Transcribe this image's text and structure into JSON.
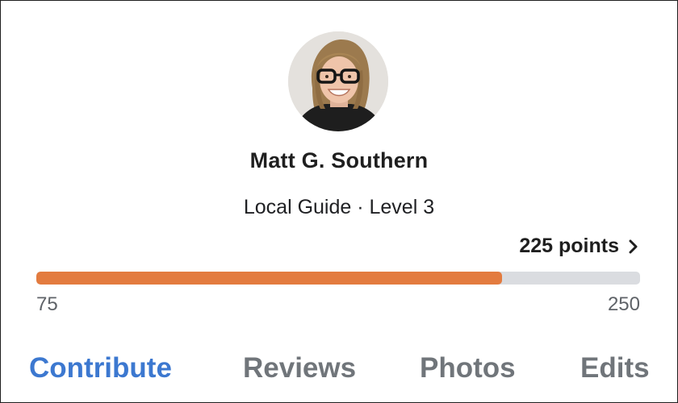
{
  "profile": {
    "name": "Matt G. Southern",
    "level": "Local Guide · Level 3"
  },
  "points": {
    "label": "225 points",
    "icon": "chevron-right-icon"
  },
  "progress": {
    "min_label": "75",
    "max_label": "250",
    "value": 225,
    "min": 75,
    "max": 250,
    "fill_color": "#e37b3f",
    "track_color": "#dadce0"
  },
  "tabs": [
    {
      "label": "Contribute",
      "active": true
    },
    {
      "label": "Reviews",
      "active": false
    },
    {
      "label": "Photos",
      "active": false
    },
    {
      "label": "Edits",
      "active": false
    }
  ],
  "colors": {
    "active_tab": "#3c78d0",
    "inactive_tab": "#70757a"
  }
}
